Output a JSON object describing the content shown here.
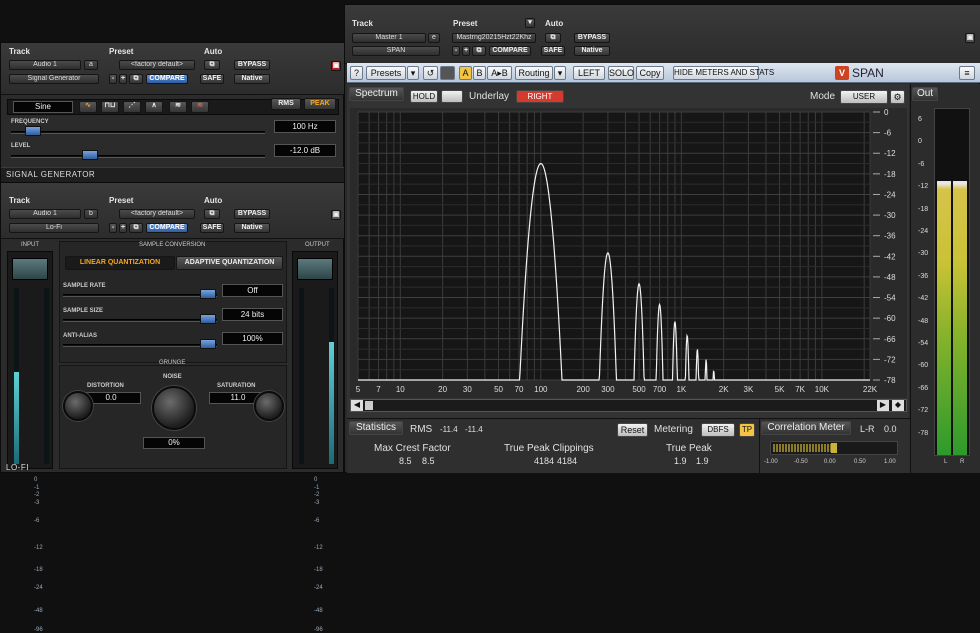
{
  "sg": {
    "track_label": "Track",
    "preset_label": "Preset",
    "auto_label": "Auto",
    "track_name": "Audio 1",
    "track_letter": "a",
    "plugin": "Signal Generator",
    "preset": "<factory default>",
    "compare": "COMPARE",
    "safe": "SAFE",
    "bypass": "BYPASS",
    "native": "Native",
    "waveform": "Sine",
    "rms": "RMS",
    "peak": "PEAK",
    "frequency_label": "FREQUENCY",
    "frequency_value": "100 Hz",
    "frequency_pos": 0.06,
    "level_label": "LEVEL",
    "level_value": "-12.0 dB",
    "level_pos": 0.3,
    "title": "SIGNAL GENERATOR"
  },
  "lofi": {
    "track_label": "Track",
    "preset_label": "Preset",
    "auto_label": "Auto",
    "track_name": "Audio 1",
    "track_letter": "b",
    "plugin": "Lo-Fi",
    "preset": "<factory default>",
    "compare": "COMPARE",
    "safe": "SAFE",
    "bypass": "BYPASS",
    "native": "Native",
    "input_label": "INPUT",
    "output_label": "OUTPUT",
    "sample_conversion": "SAMPLE CONVERSION",
    "linear": "LINEAR QUANTIZATION",
    "adaptive": "ADAPTIVE QUANTIZATION",
    "sample_rate_label": "SAMPLE RATE",
    "sample_rate_value": "Off",
    "sample_size_label": "SAMPLE SIZE",
    "sample_size_value": "24 bits",
    "anti_alias_label": "ANTI-ALIAS",
    "anti_alias_value": "100%",
    "grunge": "GRUNGE",
    "distortion_label": "DISTORTION",
    "distortion_value": "0.0",
    "noise_label": "NOISE",
    "noise_value": "0%",
    "saturation_label": "SATURATION",
    "saturation_value": "11.0",
    "title": "LO-FI",
    "meter_ticks": [
      "0",
      "-1",
      "-2",
      "-3",
      "-6",
      "-12",
      "-18",
      "-24",
      "-48",
      "-96"
    ]
  },
  "span": {
    "track_label": "Track",
    "preset_label": "Preset",
    "auto_label": "Auto",
    "track_name": "Master 1",
    "track_letter": "e",
    "plugin": "SPAN",
    "preset": "Mastrng20215Hzt22Khz",
    "compare": "COMPARE",
    "safe": "SAFE",
    "bypass": "BYPASS",
    "native": "Native",
    "toolbar": {
      "help": "?",
      "presets": "Presets",
      "a": "A",
      "b": "B",
      "atob": "A▸B",
      "routing": "Routing",
      "left": "LEFT",
      "solo": "SOLO",
      "copy": "Copy",
      "hide_meters": "HIDE METERS AND STATS",
      "brand": "SPAN"
    },
    "spectrum_label": "Spectrum",
    "hold": "HOLD",
    "underlay_label": "Underlay",
    "underlay_value": "RIGHT",
    "mode_label": "Mode",
    "mode_value": "USER",
    "out_label": "Out",
    "db_ticks": [
      "0",
      "-6",
      "-12",
      "-18",
      "-24",
      "-30",
      "-36",
      "-42",
      "-48",
      "-54",
      "-60",
      "-66",
      "-72",
      "-78"
    ],
    "freq_ticks": [
      "5",
      "7",
      "10",
      "20",
      "30",
      "50",
      "70",
      "100",
      "200",
      "300",
      "500",
      "700",
      "1K",
      "2K",
      "3K",
      "5K",
      "7K",
      "10K",
      "22K"
    ],
    "out_ticks": [
      "6",
      "0",
      "-6",
      "-12",
      "-18",
      "-24",
      "-30",
      "-36",
      "-42",
      "-48",
      "-54",
      "-60",
      "-66",
      "-72",
      "-78"
    ],
    "statistics_label": "Statistics",
    "rms_label": "RMS",
    "rms_l": "-11.4",
    "rms_r": "-11.4",
    "reset": "Reset",
    "metering_label": "Metering",
    "metering_value": "DBFS",
    "tp": "TP",
    "max_crest_label": "Max Crest Factor",
    "max_crest_l": "8.5",
    "max_crest_r": "8.5",
    "true_peak_clip_label": "True Peak Clippings",
    "tpc_l": "4184",
    "tpc_r": "4184",
    "true_peak_label": "True Peak",
    "tp_l": "1.9",
    "tp_r": "1.9",
    "corr_label": "Correlation Meter",
    "corr_mode": "L-R",
    "corr_value": "0.0",
    "corr_ticks": [
      "-1.00",
      "-0.50",
      "0.00",
      "0.50",
      "1.00"
    ],
    "meter_l": "L",
    "meter_r": "R",
    "harmonics_hz": [
      100,
      300,
      500,
      700,
      900,
      1100,
      1300,
      1500,
      1700
    ],
    "harmonics_db": [
      -15,
      -41,
      -50,
      -56,
      -61,
      -65,
      -69,
      -72,
      -75
    ]
  }
}
